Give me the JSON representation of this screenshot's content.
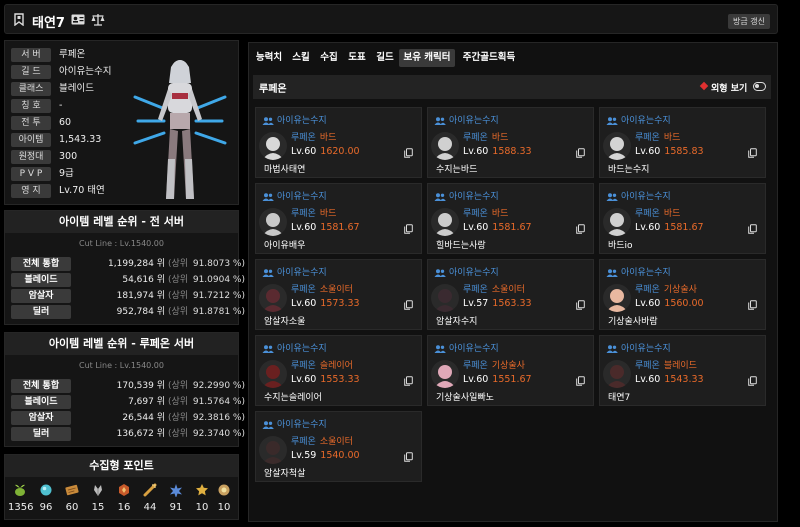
{
  "header": {
    "char_name": "태연7",
    "refresh_label": "방금 갱신"
  },
  "profile": {
    "rows": [
      {
        "label": "서 버",
        "value": "루페온"
      },
      {
        "label": "길 드",
        "value": "아이유는수지"
      },
      {
        "label": "클래스",
        "value": "블레이드"
      },
      {
        "label": "칭 호",
        "value": "-"
      },
      {
        "label": "전 투",
        "value": "60"
      },
      {
        "label": "아이템",
        "value": "1,543.33"
      },
      {
        "label": "원정대",
        "value": "300"
      },
      {
        "label": "P V P",
        "value": "9급"
      },
      {
        "label": "영 지",
        "value": "Lv.70 태연"
      }
    ]
  },
  "rank_all": {
    "title": "아이템 레벨 순위 - 전 서버",
    "cutline": "Cut Line : Lv.1540.00",
    "rows": [
      {
        "label": "전체 통합",
        "rank": "1,199,284 위",
        "sub": "(상위",
        "pct": "91.8073 %)"
      },
      {
        "label": "블레이드",
        "rank": "54,616 위",
        "sub": "(상위",
        "pct": "91.0904 %)"
      },
      {
        "label": "암살자",
        "rank": "181,974 위",
        "sub": "(상위",
        "pct": "91.7212 %)"
      },
      {
        "label": "딜러",
        "rank": "952,784 위",
        "sub": "(상위",
        "pct": "91.8781 %)"
      }
    ]
  },
  "rank_server": {
    "title": "아이템 레벨 순위 - 루페온 서버",
    "cutline": "Cut Line : Lv.1540.00",
    "rows": [
      {
        "label": "전체 통합",
        "rank": "170,539 위",
        "sub": "(상위",
        "pct": "92.2990 %)"
      },
      {
        "label": "블레이드",
        "rank": "7,697 위",
        "sub": "(상위",
        "pct": "91.5764 %)"
      },
      {
        "label": "암살자",
        "rank": "26,544 위",
        "sub": "(상위",
        "pct": "92.3816 %)"
      },
      {
        "label": "딜러",
        "rank": "136,672 위",
        "sub": "(상위",
        "pct": "92.3740 %)"
      }
    ]
  },
  "points": {
    "title": "수집형 포인트",
    "items": [
      {
        "icon": "mokoko-seed-icon",
        "color": "#7fb236",
        "value": "1356"
      },
      {
        "icon": "island-heart-icon",
        "color": "#4fc0d0",
        "value": "96"
      },
      {
        "icon": "masterpiece-icon",
        "color": "#c88a3a",
        "value": "60"
      },
      {
        "icon": "giant-heart-icon",
        "color": "#bbbbbb",
        "value": "15"
      },
      {
        "icon": "ignea-token-icon",
        "color": "#c85a2a",
        "value": "16"
      },
      {
        "icon": "sea-bounty-icon",
        "color": "#d8a040",
        "value": "44"
      },
      {
        "icon": "world-tree-leaf-icon",
        "color": "#5a8ad8",
        "value": "91"
      },
      {
        "icon": "orpheus-star-icon",
        "color": "#e0b040",
        "value": "10"
      },
      {
        "icon": "omnium-star-icon",
        "color": "#c8a060",
        "value": "10"
      }
    ]
  },
  "tabs": [
    {
      "label": "능력치",
      "active": false
    },
    {
      "label": "스킬",
      "active": false
    },
    {
      "label": "수집",
      "active": false
    },
    {
      "label": "도표",
      "active": false
    },
    {
      "label": "길드",
      "active": false
    },
    {
      "label": "보유 캐릭터",
      "active": true
    },
    {
      "label": "주간골드획득",
      "active": false
    }
  ],
  "server_section": {
    "name": "루페온",
    "view_label": "외형 보기"
  },
  "colors": {
    "guild": "#4a90d8",
    "accent": "#e86a2a"
  },
  "characters": [
    {
      "guild": "아이유는수지",
      "server": "루페온",
      "class": "바드",
      "level": "Lv.60",
      "ilvl": "1620.00",
      "name": "마법사태연",
      "avatar": "#d8d8d8"
    },
    {
      "guild": "아이유는수지",
      "server": "루페온",
      "class": "바드",
      "level": "Lv.60",
      "ilvl": "1588.33",
      "name": "수지는바드",
      "avatar": "#d0d0d0"
    },
    {
      "guild": "아이유는수지",
      "server": "루페온",
      "class": "바드",
      "level": "Lv.60",
      "ilvl": "1585.83",
      "name": "바드는수지",
      "avatar": "#d4d4d4"
    },
    {
      "guild": "아이유는수지",
      "server": "루페온",
      "class": "바드",
      "level": "Lv.60",
      "ilvl": "1581.67",
      "name": "아이유배우",
      "avatar": "#c8c8c8"
    },
    {
      "guild": "아이유는수지",
      "server": "루페온",
      "class": "바드",
      "level": "Lv.60",
      "ilvl": "1581.67",
      "name": "힐바드는사랑",
      "avatar": "#cccccc"
    },
    {
      "guild": "아이유는수지",
      "server": "루페온",
      "class": "바드",
      "level": "Lv.60",
      "ilvl": "1581.67",
      "name": "바드io",
      "avatar": "#d0d0d0"
    },
    {
      "guild": "아이유는수지",
      "server": "루페온",
      "class": "소울이터",
      "level": "Lv.60",
      "ilvl": "1573.33",
      "name": "암살자소울",
      "avatar": "#5a2a30"
    },
    {
      "guild": "아이유는수지",
      "server": "루페온",
      "class": "소울이터",
      "level": "Lv.57",
      "ilvl": "1563.33",
      "name": "암살자수지",
      "avatar": "#3a2a30"
    },
    {
      "guild": "아이유는수지",
      "server": "루페온",
      "class": "기상술사",
      "level": "Lv.60",
      "ilvl": "1560.00",
      "name": "기상술사바람",
      "avatar": "#e8b8a0"
    },
    {
      "guild": "아이유는수지",
      "server": "루페온",
      "class": "슬레이어",
      "level": "Lv.60",
      "ilvl": "1553.33",
      "name": "수지는슬레이어",
      "avatar": "#6a2020"
    },
    {
      "guild": "아이유는수지",
      "server": "루페온",
      "class": "기상술사",
      "level": "Lv.60",
      "ilvl": "1551.67",
      "name": "기상술사일빠노",
      "avatar": "#e0a8b8"
    },
    {
      "guild": "아이유는수지",
      "server": "루페온",
      "class": "블레이드",
      "level": "Lv.60",
      "ilvl": "1543.33",
      "name": "태연7",
      "avatar": "#4a2a2a"
    },
    {
      "guild": "아이유는수지",
      "server": "루페온",
      "class": "소울이터",
      "level": "Lv.59",
      "ilvl": "1540.00",
      "name": "암살자척살",
      "avatar": "#3a2a2a"
    }
  ]
}
